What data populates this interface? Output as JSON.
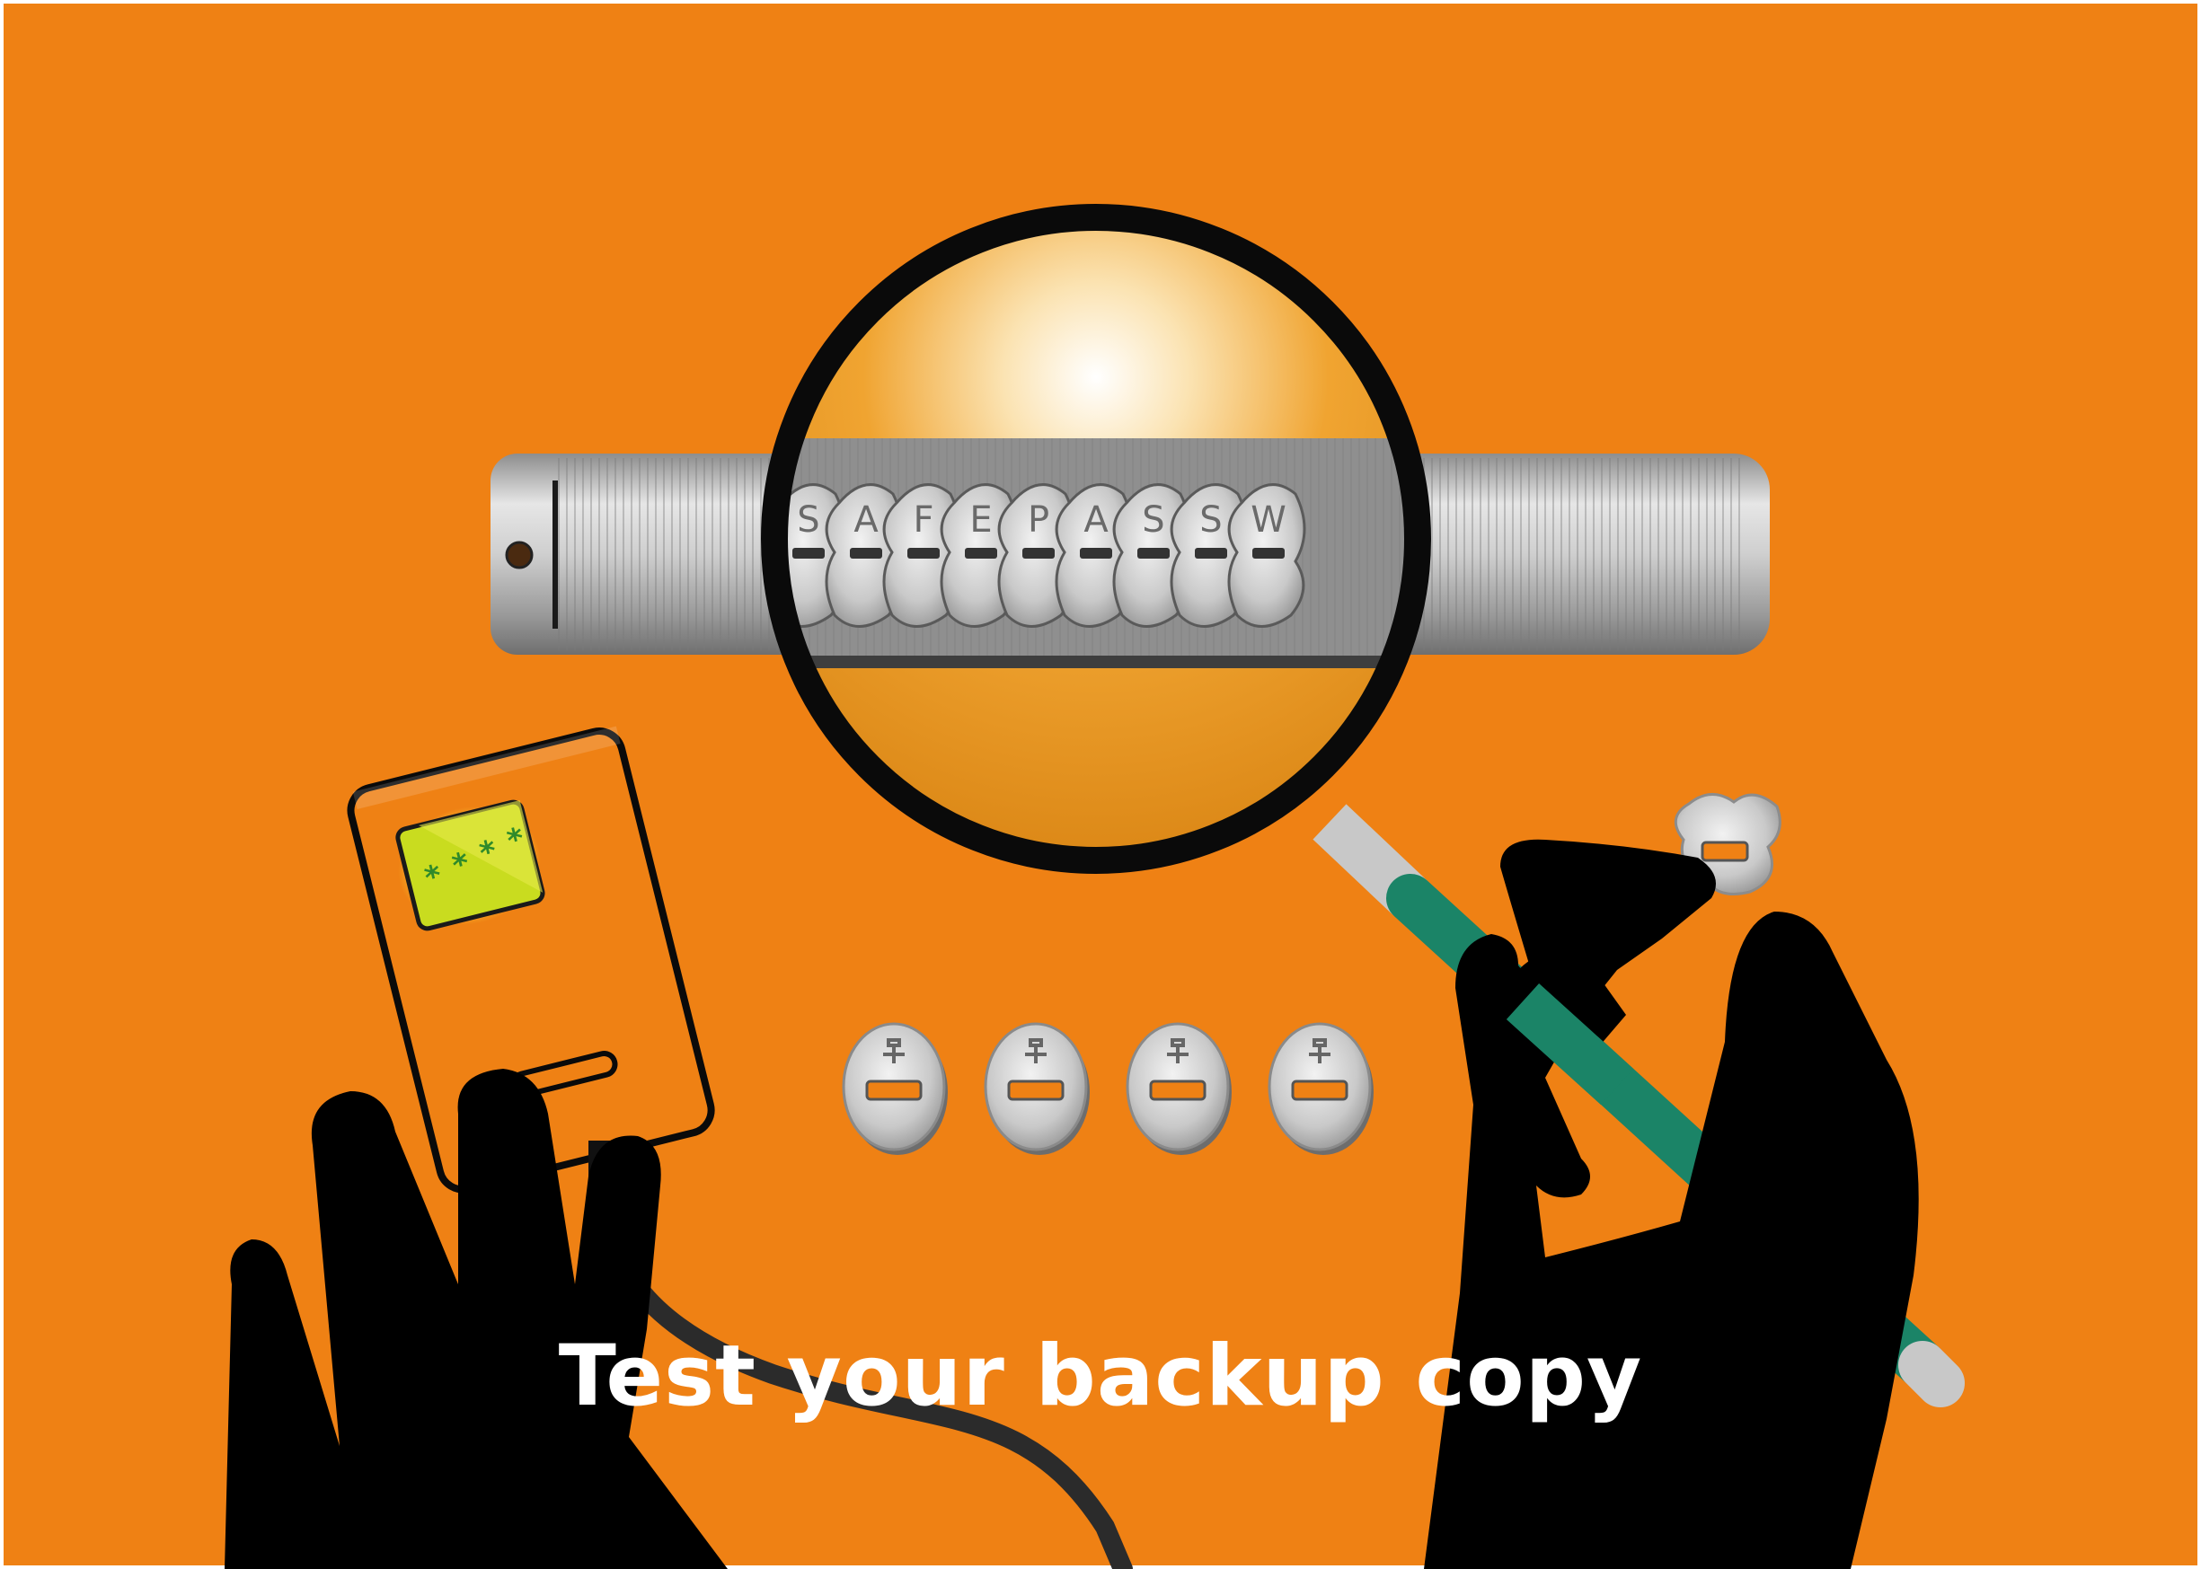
{
  "caption": "Test your backup copy",
  "cylinder_letters": [
    "S",
    "A",
    "F",
    "E",
    "P",
    "A",
    "S",
    "S",
    "W"
  ],
  "device_screen_symbols": [
    "*",
    "*",
    "*",
    "*"
  ],
  "spare_tiles_count": 4,
  "icons": [
    "magnifier-icon",
    "combination-cylinder-icon",
    "backup-device-icon",
    "hand-icon",
    "key-icon"
  ],
  "colors": {
    "background": "#ef8114",
    "silhouette": "#000000",
    "handle": "#1b8467",
    "device_screen": "#c9dc1f",
    "metal": "#c7c7c7"
  }
}
